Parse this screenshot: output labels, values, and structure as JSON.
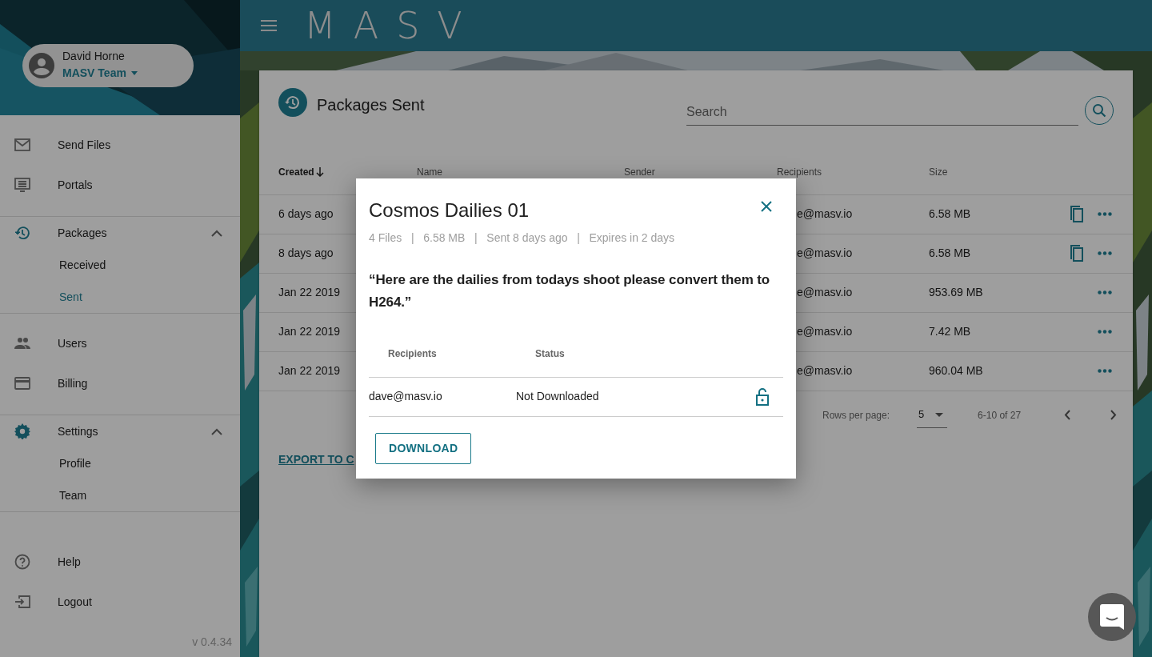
{
  "sidebar": {
    "user": {
      "name": "David Horne",
      "team": "MASV Team"
    },
    "sections": [
      {
        "items": [
          {
            "label": "Send Files"
          },
          {
            "label": "Portals"
          }
        ]
      },
      {
        "items": [
          {
            "label": "Packages",
            "expanded": true,
            "children": [
              {
                "label": "Received",
                "selected": false
              },
              {
                "label": "Sent",
                "selected": true
              }
            ]
          }
        ]
      },
      {
        "items": [
          {
            "label": "Users"
          },
          {
            "label": "Billing"
          }
        ]
      },
      {
        "items": [
          {
            "label": "Settings",
            "expanded": true,
            "children": [
              {
                "label": "Profile",
                "selected": false
              },
              {
                "label": "Team",
                "selected": false
              }
            ]
          }
        ]
      },
      {
        "items": [
          {
            "label": "Help"
          },
          {
            "label": "Logout"
          }
        ]
      }
    ],
    "version": "v 0.4.34"
  },
  "topbar": {
    "logo": "MASV"
  },
  "page": {
    "title": "Packages Sent",
    "search": {
      "placeholder": "Search"
    },
    "table": {
      "columns": [
        {
          "label": "Created",
          "sorted": true
        },
        {
          "label": "Name",
          "sorted": false
        },
        {
          "label": "Sender",
          "sorted": false
        },
        {
          "label": "Recipients",
          "sorted": false
        },
        {
          "label": "Size",
          "sorted": false
        }
      ],
      "rows": [
        {
          "created": "6 days ago",
          "recipients": "e@masv.io",
          "size": "6.58 MB",
          "copy": true
        },
        {
          "created": "8 days ago",
          "recipients": "e@masv.io",
          "size": "6.58 MB",
          "copy": true
        },
        {
          "created": "Jan 22 2019",
          "recipients": "e@masv.io",
          "size": "953.69 MB",
          "copy": false
        },
        {
          "created": "Jan 22 2019",
          "recipients": "e@masv.io",
          "size": "7.42 MB",
          "copy": false
        },
        {
          "created": "Jan 22 2019",
          "recipients": "e@masv.io",
          "size": "960.04 MB",
          "copy": false
        }
      ]
    },
    "pagination": {
      "label": "Rows per page:",
      "rows_per_page": "5",
      "range": "6-10 of 27"
    },
    "export_link": "EXPORT TO C"
  },
  "dialog": {
    "title": "Cosmos Dailies 01",
    "meta": "4 Files   |   6.58 MB   |   Sent 8 days ago   |   Expires in 2 days",
    "message": "“Here are the dailies from todays shoot please convert them to H264.”",
    "columns": [
      "Recipients",
      "Status"
    ],
    "recipients": [
      {
        "email": "dave@masv.io",
        "status": "Not Downloaded"
      }
    ],
    "button": "DOWNLOAD"
  }
}
